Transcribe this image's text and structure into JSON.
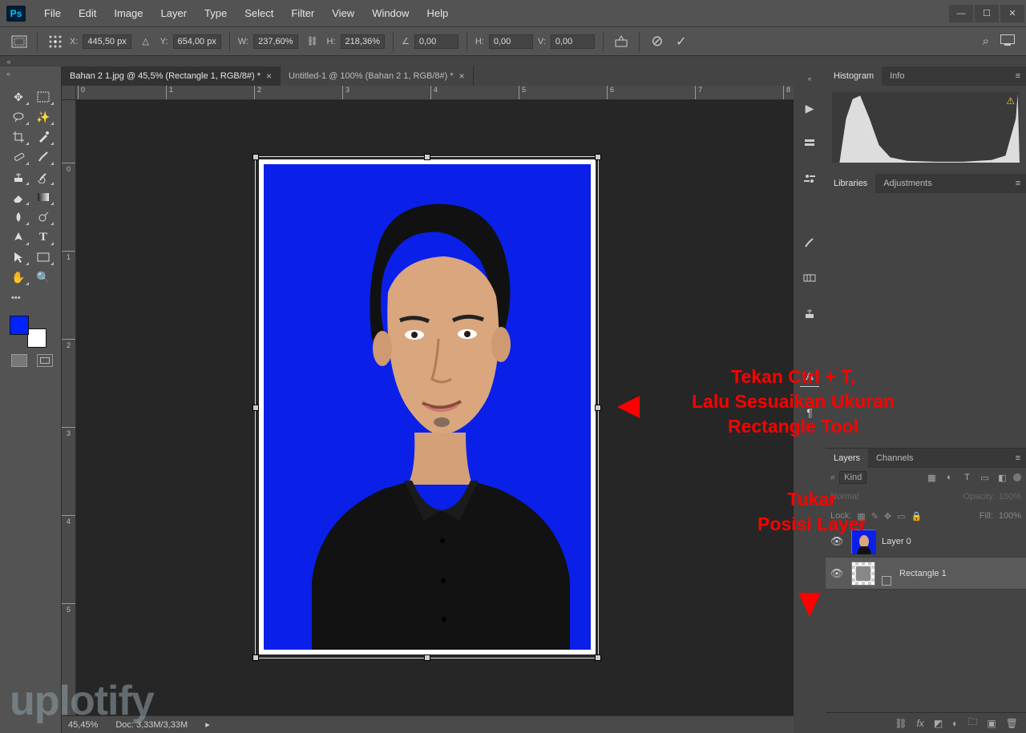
{
  "app": {
    "logo": "Ps"
  },
  "menu": [
    "File",
    "Edit",
    "Image",
    "Layer",
    "Type",
    "Select",
    "Filter",
    "View",
    "Window",
    "Help"
  ],
  "window_controls": [
    "minimize",
    "maximize",
    "close"
  ],
  "options": {
    "x_label": "X:",
    "x": "445,50 px",
    "y_label": "Y:",
    "y": "654,00 px",
    "w_label": "W:",
    "w": "237,60%",
    "h_label": "H:",
    "h": "218,36%",
    "angle_label": "∠",
    "angle": "0,00",
    "skew_h_label": "H:",
    "skew_h": "0,00",
    "skew_v_label": "V:",
    "skew_v": "0,00"
  },
  "tabs": [
    {
      "title": "Bahan 2 1.jpg @ 45,5% (Rectangle 1, RGB/8#) *",
      "active": true
    },
    {
      "title": "Untitled-1 @ 100% (Bahan 2 1, RGB/8#) *",
      "active": false
    }
  ],
  "tools": [
    "move",
    "rect-marquee",
    "lasso",
    "magic-wand",
    "crop",
    "eyedropper",
    "healing",
    "brush",
    "clone",
    "history-brush",
    "eraser",
    "gradient",
    "blur",
    "dodge",
    "pen",
    "type",
    "path-select",
    "rectangle",
    "hand",
    "zoom"
  ],
  "colors": {
    "fg": "#0022ff",
    "bg": "#ffffff"
  },
  "ruler_h": [
    "0",
    "1",
    "2",
    "3",
    "4",
    "5",
    "6",
    "7",
    "8"
  ],
  "ruler_v": [
    "0",
    "1",
    "2",
    "3",
    "4",
    "5"
  ],
  "right_strip": [
    "play",
    "speaker",
    "adjust",
    "brush-presets",
    "swatches",
    "character",
    "vertical-type",
    "paragraph"
  ],
  "panels": {
    "hist": {
      "tab1": "Histogram",
      "tab2": "Info"
    },
    "lib": {
      "tab1": "Libraries",
      "tab2": "Adjustments"
    },
    "layers": {
      "tab1": "Layers",
      "tab2": "Channels",
      "kind": "Kind",
      "blend": "Normal",
      "opacity_label": "Opacity:",
      "opacity": "100%",
      "lock_label": "Lock:",
      "fill_label": "Fill:",
      "fill": "100%",
      "items": [
        {
          "name": "Layer 0",
          "selected": false,
          "checker": false
        },
        {
          "name": "Rectangle 1",
          "selected": true,
          "checker": true
        }
      ]
    }
  },
  "status": {
    "zoom": "45,45%",
    "doc": "Doc: 3,33M/3,33M"
  },
  "annotations": {
    "a1_l1": "Tekan Ctrl + T,",
    "a1_l2": "Lalu Sesuaikan Ukuran",
    "a1_l3": "Rectangle Tool",
    "a2_l1": "Tukar",
    "a2_l2": "Posisi Layer"
  },
  "watermark": "uplotify"
}
